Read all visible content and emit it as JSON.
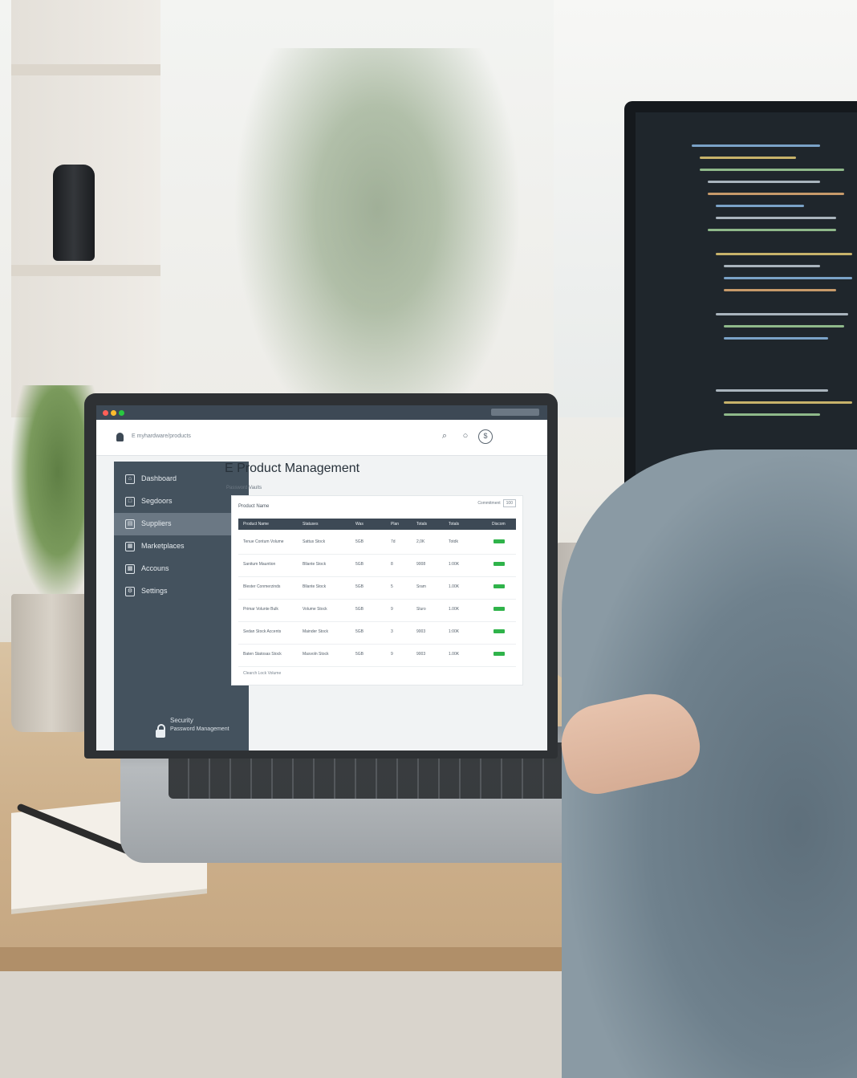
{
  "app": {
    "window_name": "E myhardware/products",
    "title": "E Product Management",
    "subtitle": "Password Vaults"
  },
  "sidebar": {
    "items": [
      {
        "label": "Dashboard",
        "icon": "home-icon"
      },
      {
        "label": "Segdoors",
        "icon": "box-icon"
      },
      {
        "label": "Suppliers",
        "icon": "truck-icon",
        "active": true
      },
      {
        "label": "Marketplaces",
        "icon": "store-icon"
      },
      {
        "label": "Accouns",
        "icon": "user-icon"
      },
      {
        "label": "Settings",
        "icon": "gear-icon"
      }
    ],
    "security_label": "Security",
    "security_sub": "Password Management"
  },
  "toolbar_icons": [
    "search-icon",
    "bell-icon",
    "user-icon"
  ],
  "card": {
    "label": "Product Name",
    "control_label": "Commitment",
    "control_value": "100",
    "footer": "Clearch Lock Volume",
    "columns": [
      "Product Name",
      "Statuses",
      "Was",
      "Plan",
      "Totals",
      "Totals",
      "Discom"
    ],
    "rows": [
      [
        "Tenue Contum Volume",
        "Sattus Stock",
        "5GB",
        "7d",
        "2,0K",
        "Totdk",
        "green"
      ],
      [
        "Sanitum Mauntion",
        "Bllante Stock",
        "5GB",
        "8",
        "9008",
        "1:00K",
        "green"
      ],
      [
        "Blester Conmerzinds",
        "Bllante Stock",
        "5GB",
        "5",
        "Sram",
        "1.00K",
        "green"
      ],
      [
        "Primar Volunte Bulk",
        "Volume Stock",
        "5GB",
        "9",
        "Sluro",
        "1.00K",
        "green"
      ],
      [
        "Sedan Stock Accents",
        "Mainder Stock",
        "5GB",
        "3",
        "9003",
        "1:00K",
        "green"
      ],
      [
        "Baten Statosas Stock",
        "Masvoln Stock",
        "5GB",
        "9",
        "9003",
        "1.00K",
        "green"
      ]
    ]
  },
  "colors": {
    "sidebar_bg": "#44525e",
    "active_item": "#6b7884",
    "header_bg": "#3d4955",
    "status_green": "#2fb34a"
  }
}
